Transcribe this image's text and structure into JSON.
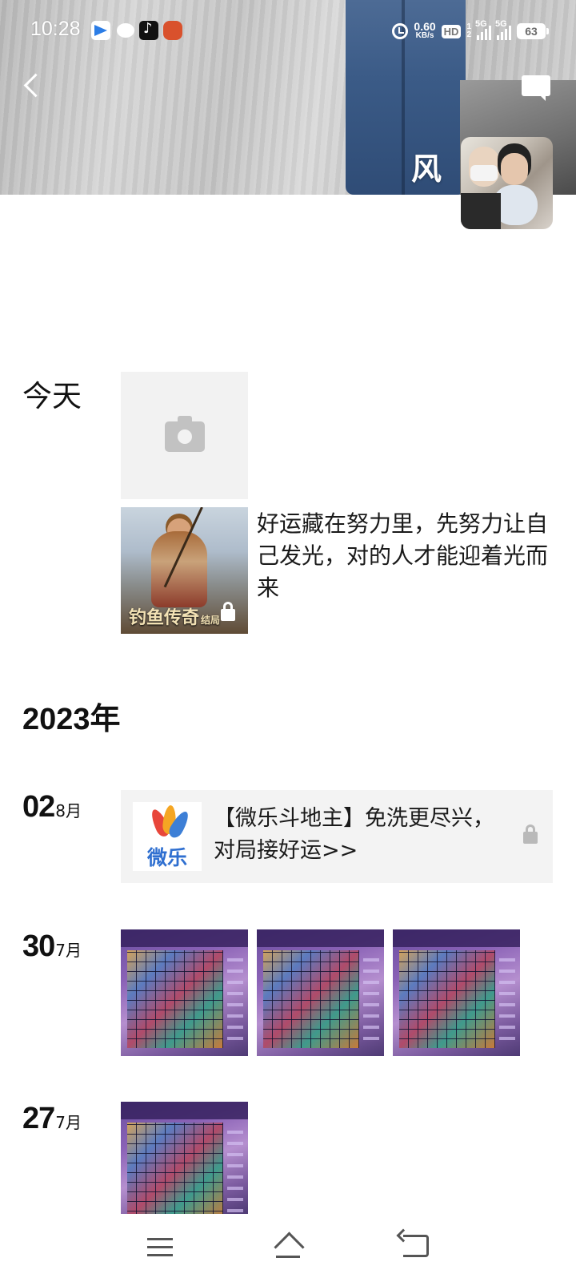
{
  "status_bar": {
    "time": "10:28",
    "net_speed_value": "0.60",
    "net_speed_unit": "KB/s",
    "hd": "HD",
    "sim1": "1",
    "sim2": "2",
    "net1": "5G",
    "net2": "5G",
    "battery": "63"
  },
  "header": {
    "profile_name": "风"
  },
  "feed": {
    "today_label": "今天",
    "today_post_text": "好运藏在努力里，先努力让自己发光，对的人才能迎着光而来",
    "today_game_title": "钓鱼传奇",
    "today_game_title_suffix": "结局",
    "year_label": "2023年",
    "entries": [
      {
        "day": "02",
        "month": "8月",
        "ad_logo_text": "微乐",
        "ad_text": "【微乐斗地主】免洗更尽兴，对局接好运>>"
      },
      {
        "day": "30",
        "month": "7月",
        "image_count": 3
      },
      {
        "day": "27",
        "month": "7月",
        "image_count": 1
      }
    ]
  },
  "icons": {
    "back": "back-arrow-icon",
    "message": "message-icon",
    "camera": "camera-icon",
    "lock": "lock-icon",
    "menu": "menu-icon",
    "home": "home-icon",
    "return": "return-icon"
  }
}
